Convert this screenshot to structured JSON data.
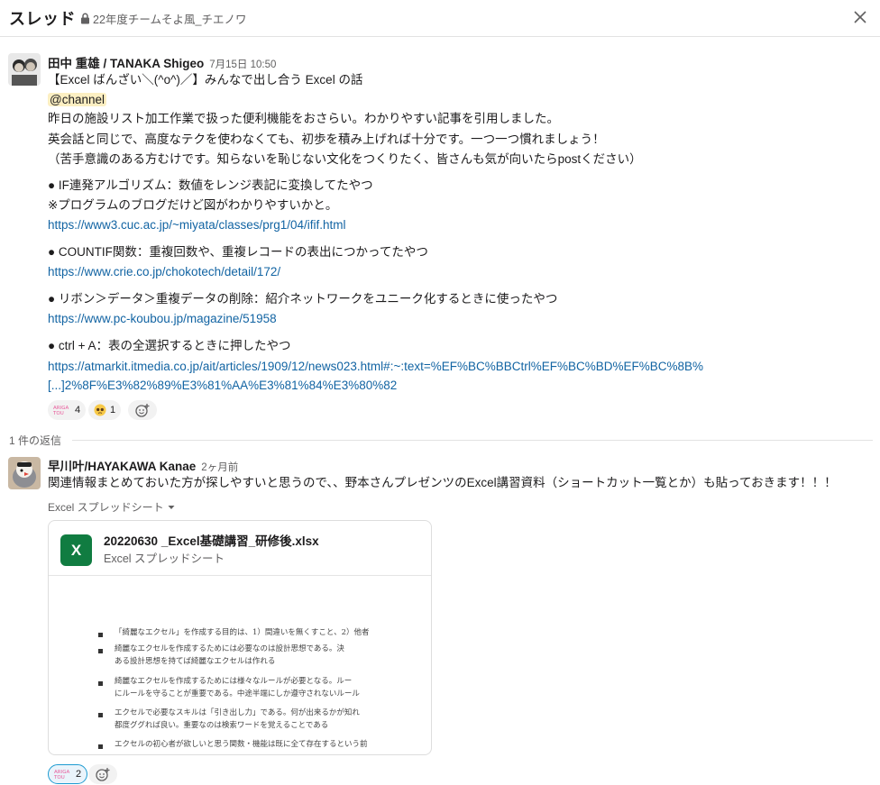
{
  "header": {
    "title": "スレッド",
    "channel": "22年度チームそよ風_チエノワ"
  },
  "parent": {
    "author": "田中 重雄 / TANAKA Shigeo",
    "time": "7月15日 10:50",
    "lines": {
      "l1": "【Excel ばんざい＼(^o^)／】みんなで出し合う Excel の話",
      "mention": "@channel",
      "l3": "昨日の施設リスト加工作業で扱った便利機能をおさらい。わかりやすい記事を引用しました。",
      "l4": "英会話と同じで、高度なテクを使わなくても、初歩を積み上げれば十分です。一つ一つ慣れましょう！",
      "l5": "（苦手意識のある方むけです。知らないを恥じない文化をつくりたく、皆さんも気が向いたらpostください）",
      "b1a": "● IF連発アルゴリズム：数値をレンジ表記に変換してたやつ",
      "b1b": "※プログラムのブログだけど図がわかりやすいかと。",
      "b1link": "https://www3.cuc.ac.jp/~miyata/classes/prg1/04/ifif.html",
      "b2": "● COUNTIF関数：重複回数や、重複レコードの表出につかってたやつ",
      "b2link": "https://www.crie.co.jp/chokotech/detail/172/",
      "b3": "● リボン＞データ＞重複データの削除：紹介ネットワークをユニーク化するときに使ったやつ",
      "b3link": "https://www.pc-koubou.jp/magazine/51958",
      "b4": "● ctrl + A：表の全選択するときに押したやつ",
      "b4link1": "https://atmarkit.itmedia.co.jp/ait/articles/1909/12/news023.html#:~:text=%EF%BC%BBCtrl%EF%BC%BD%EF%BC%8B%",
      "b4link2": "[...]2%8F%E3%82%89%E3%81%AA%E3%81%84%E3%80%82"
    },
    "reactions": [
      {
        "emoji": "arigato-icon",
        "count": "4"
      },
      {
        "emoji": "pleading-face-icon",
        "count": "1"
      }
    ]
  },
  "replies_label": "1 件の返信",
  "reply": {
    "author": "早川叶/HAYAKAWA Kanae",
    "time": "2ヶ月前",
    "text": "関連情報まとめておいた方が探しやすいと思うので、、野本さんプレゼンツのExcel講習資料（ショートカット一覧とか）も貼っておきます！！！",
    "file_label": "Excel スプレッドシート",
    "file": {
      "name": "20220630 _Excel基礎講習_研修後.xlsx",
      "type": "Excel スプレッドシート",
      "icon_letter": "X",
      "preview_lines": [
        "「綺麗なエクセル」を作成する目的は、1）間違いを無くすこと、2）他者",
        "綺麗なエクセルを作成するためには必要なのは設計思想である。決",
        "ある設計思想を持てば綺麗なエクセルは作れる",
        "綺麗なエクセルを作成するためには様々なルールが必要となる。ルー",
        "にルールを守ることが重要である。中途半端にしか遵守されないルール",
        "エクセルで必要なスキルは「引き出し力」である。何が出来るかが知れ",
        "都度ググれば良い。重要なのは検索ワードを覚えることである",
        "エクセルの初心者が欲しいと思う関数・機能は既に全て存在するという前"
      ]
    },
    "reactions": [
      {
        "emoji": "arigato-icon",
        "count": "2"
      }
    ]
  },
  "colors": {
    "link": "#1264a3",
    "mention_bg": "#fcefc2",
    "excel_green": "#107c41",
    "active_reaction_border": "#1d9bd1"
  }
}
